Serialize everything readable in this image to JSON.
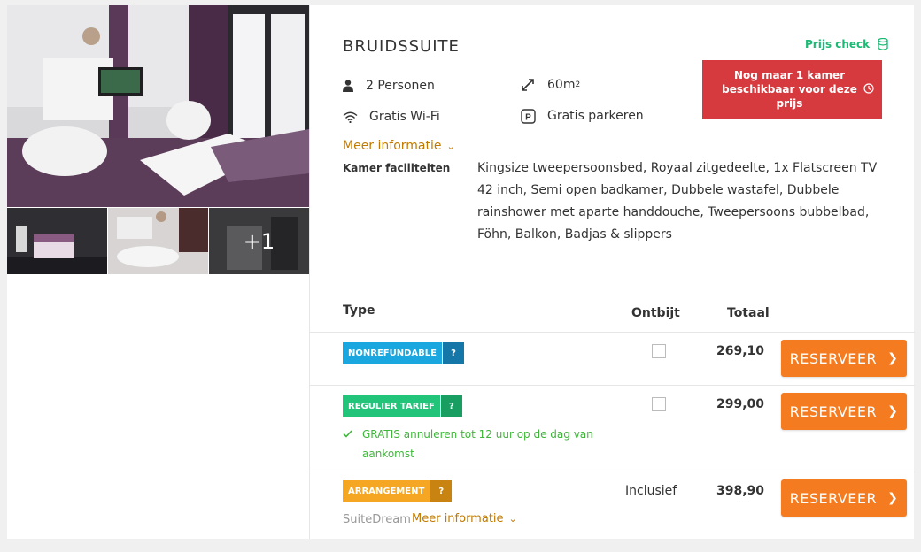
{
  "room": {
    "title": "BRUIDSSUITE",
    "persons": "2 Personen",
    "size": "60m",
    "size_unit_sup": "2",
    "wifi": "Gratis Wi-Fi",
    "parking": "Gratis parkeren",
    "more_info": "Meer informatie",
    "facilities_label": "Kamer faciliteiten",
    "facilities_text": "Kingsize tweepersoonsbed, Royaal zitgedeelte, 1x Flatscreen TV 42 inch, Semi open badkamer, Dubbele wastafel, Dubbele rainshower met aparte handdouche, Tweepersoons bubbelbad, Föhn, Balkon, Badjas & slippers"
  },
  "gallery": {
    "more_count": "+1"
  },
  "price_check": "Prijs check",
  "availability_alert": "Nog maar 1 kamer beschikbaar voor deze prijs",
  "table": {
    "headers": {
      "type": "Type",
      "breakfast": "Ontbijt",
      "total": "Totaal"
    },
    "rows": [
      {
        "badge": "NONREFUNDABLE",
        "badge_color": "#1aa7e0",
        "badge_q_color": "#1576a8",
        "q": "?",
        "breakfast_checked": false,
        "price": "269,10",
        "button": "RESERVEER"
      },
      {
        "badge": "REGULIER TARIEF",
        "badge_color": "#22c47a",
        "badge_q_color": "#179e60",
        "q": "?",
        "breakfast_checked": false,
        "price": "299,00",
        "button": "RESERVEER",
        "note": "GRATIS annuleren tot 12 uur op de dag van aankomst"
      },
      {
        "badge": "ARRANGEMENT",
        "badge_color": "#f5a623",
        "badge_q_color": "#c98310",
        "q": "?",
        "breakfast": "Inclusief",
        "price": "398,90",
        "button": "RESERVEER",
        "package_name": "SuiteDream",
        "package_more": "Meer informatie"
      }
    ]
  },
  "colors": {
    "accent_orange": "#f47b20",
    "link_gold": "#c07a00",
    "alert_red": "#d63a3f",
    "success_green": "#3fb63a",
    "price_check_green": "#1cb974"
  }
}
